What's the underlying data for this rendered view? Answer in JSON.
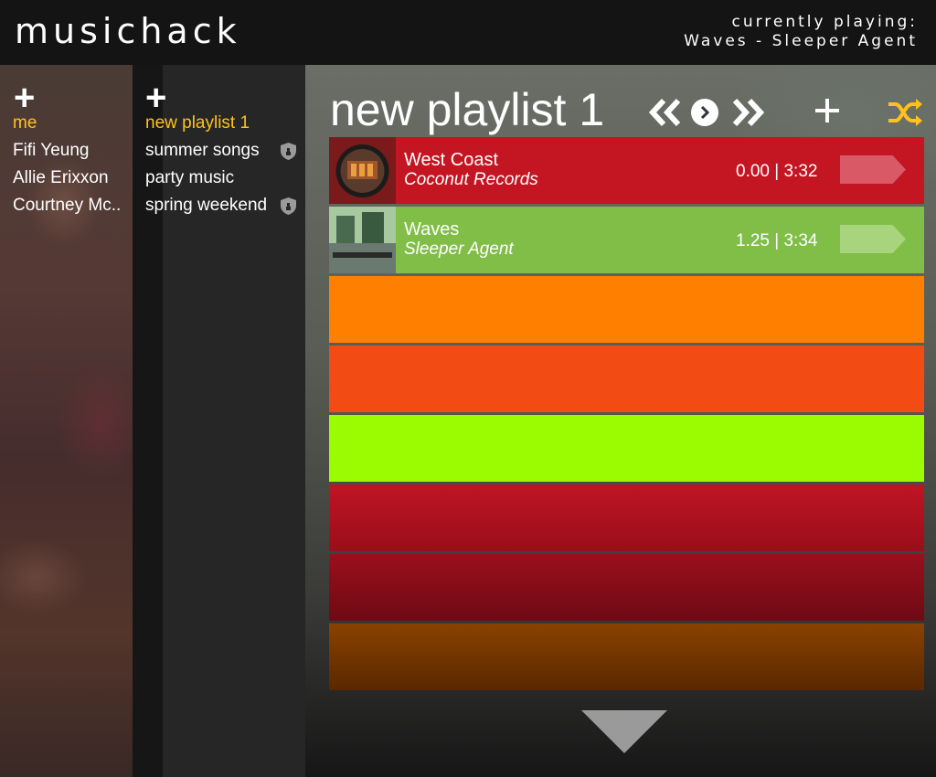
{
  "app": {
    "title": "musichack"
  },
  "now_playing": {
    "label": "currently playing:",
    "track": "Waves - Sleeper Agent"
  },
  "friends": {
    "add_icon": "plus-icon",
    "items": [
      {
        "label": "me",
        "active": true
      },
      {
        "label": "Fifi Yeung",
        "active": false
      },
      {
        "label": "Allie Erixxon",
        "active": false
      },
      {
        "label": "Courtney Mc..",
        "active": false
      }
    ]
  },
  "playlists": {
    "add_icon": "plus-icon",
    "items": [
      {
        "label": "new playlist 1",
        "active": true,
        "locked": false
      },
      {
        "label": "summer songs",
        "active": false,
        "locked": true
      },
      {
        "label": "party music",
        "active": false,
        "locked": false
      },
      {
        "label": "spring weekend",
        "active": false,
        "locked": true
      }
    ]
  },
  "main": {
    "title": "new playlist 1",
    "controls": [
      "rewind-icon",
      "play-icon",
      "fast-forward-icon",
      "plus-icon",
      "shuffle-icon"
    ],
    "tracks": [
      {
        "title": "West Coast",
        "artist": "Coconut Records",
        "time": "0.00 | 3:32",
        "color": "#c41523"
      },
      {
        "title": "Waves",
        "artist": "Sleeper Agent",
        "time": "1.25 | 3:34",
        "color": "#80be47"
      }
    ],
    "empty_row_colors": [
      "#ff8000",
      "#f24b13",
      "#9bfb00",
      "#b0101e",
      "#8b0d19",
      "#7a3a00"
    ]
  },
  "colors": {
    "accent": "#ffc21a",
    "topbar": "#141414"
  }
}
